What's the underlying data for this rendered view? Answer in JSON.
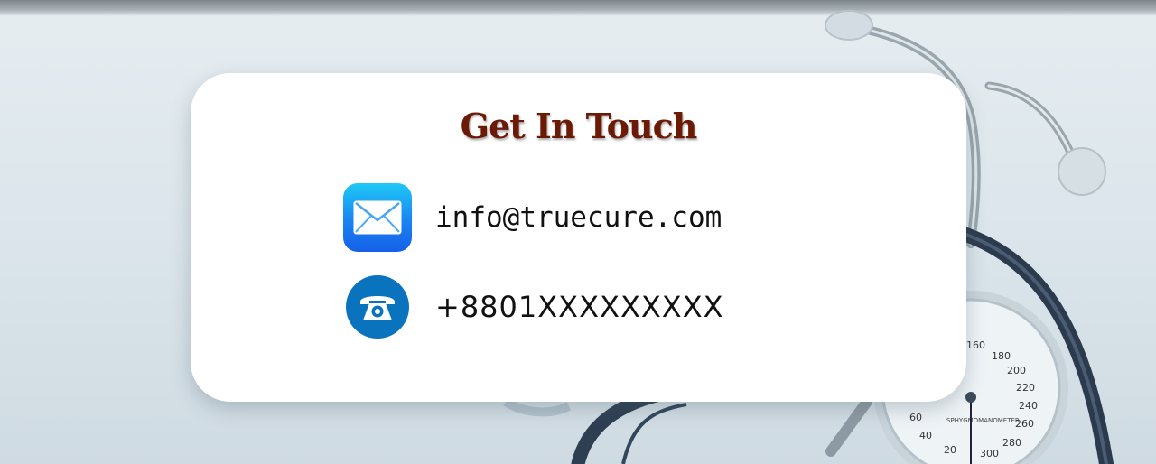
{
  "card": {
    "title": "Get In Touch"
  },
  "contacts": [
    {
      "type": "email",
      "icon": "envelope-icon",
      "value": "info@truecure.com"
    },
    {
      "type": "phone",
      "icon": "telephone-icon",
      "value": "+8801XXXXXXXXX"
    }
  ],
  "gauge": {
    "label": "SPHYGMOMANOMETER",
    "ticks": [
      "20",
      "40",
      "60",
      "160",
      "180",
      "200",
      "220",
      "240",
      "260",
      "280",
      "300"
    ]
  },
  "colors": {
    "title": "#6b1a06",
    "phone_icon_bg": "#0a73bd",
    "mail_icon_top": "#1fc8f6",
    "mail_icon_bottom": "#1560e8"
  }
}
